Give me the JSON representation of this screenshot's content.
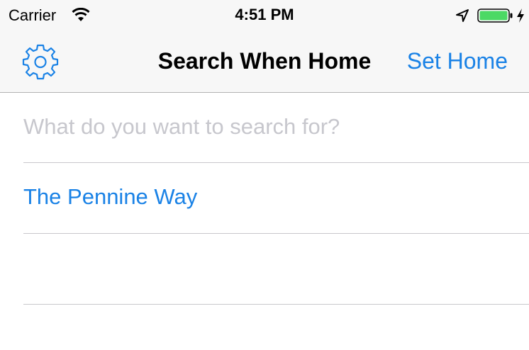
{
  "status_bar": {
    "carrier": "Carrier",
    "time": "4:51 PM",
    "battery_color": "#4cd964",
    "wifi_icon": "wifi-icon",
    "location_icon": "location-arrow-icon",
    "charging_icon": "lightning-bolt-icon"
  },
  "nav": {
    "title": "Search When Home",
    "right_button": "Set Home",
    "left_icon": "gear-icon",
    "accent": "#1a82e6"
  },
  "search": {
    "placeholder": "What do you want to search for?",
    "value": ""
  },
  "results": [
    {
      "label": "The Pennine Way"
    },
    {
      "label": ""
    }
  ]
}
